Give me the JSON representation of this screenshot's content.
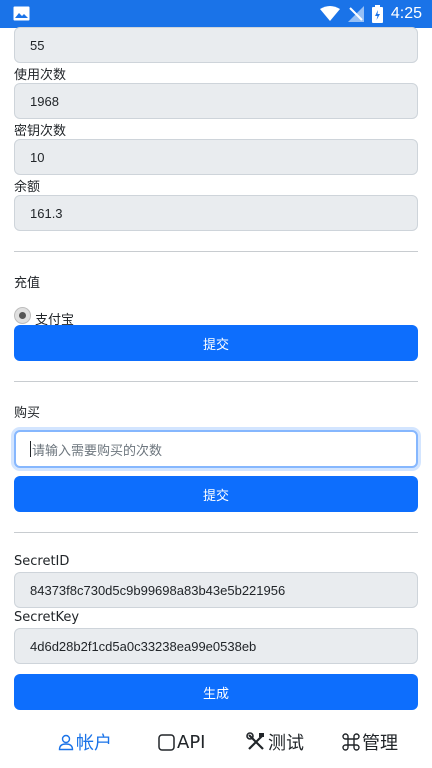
{
  "status_bar": {
    "time": "4:25"
  },
  "fields": {
    "top_value": "55",
    "usage_label": "使用次数",
    "usage_value": "1968",
    "key_count_label": "密钥次数",
    "key_count_value": "10",
    "balance_label": "余额",
    "balance_value": "161.3"
  },
  "recharge": {
    "title": "充值",
    "option": "支付宝",
    "submit_label": "提交"
  },
  "purchase": {
    "title": "购买",
    "placeholder": "请输入需要购买的次数",
    "submit_label": "提交"
  },
  "secret": {
    "id_label": "SecretID",
    "id_value": "84373f8c730d5c9b99698a83b43e5b221956",
    "key_label": "SecretKey",
    "key_value": "4d6d28b2f1cd5a0c33238ea99e0538eb",
    "generate_label": "生成"
  },
  "tabs": [
    {
      "label": "帐户",
      "icon": "person-icon",
      "active": true
    },
    {
      "label": "API",
      "icon": "square-icon",
      "active": false
    },
    {
      "label": "测试",
      "icon": "tools-icon",
      "active": false
    },
    {
      "label": "管理",
      "icon": "command-icon",
      "active": false
    }
  ],
  "colors": {
    "primary": "#0d6efd",
    "status_bar": "#1a73e8"
  }
}
